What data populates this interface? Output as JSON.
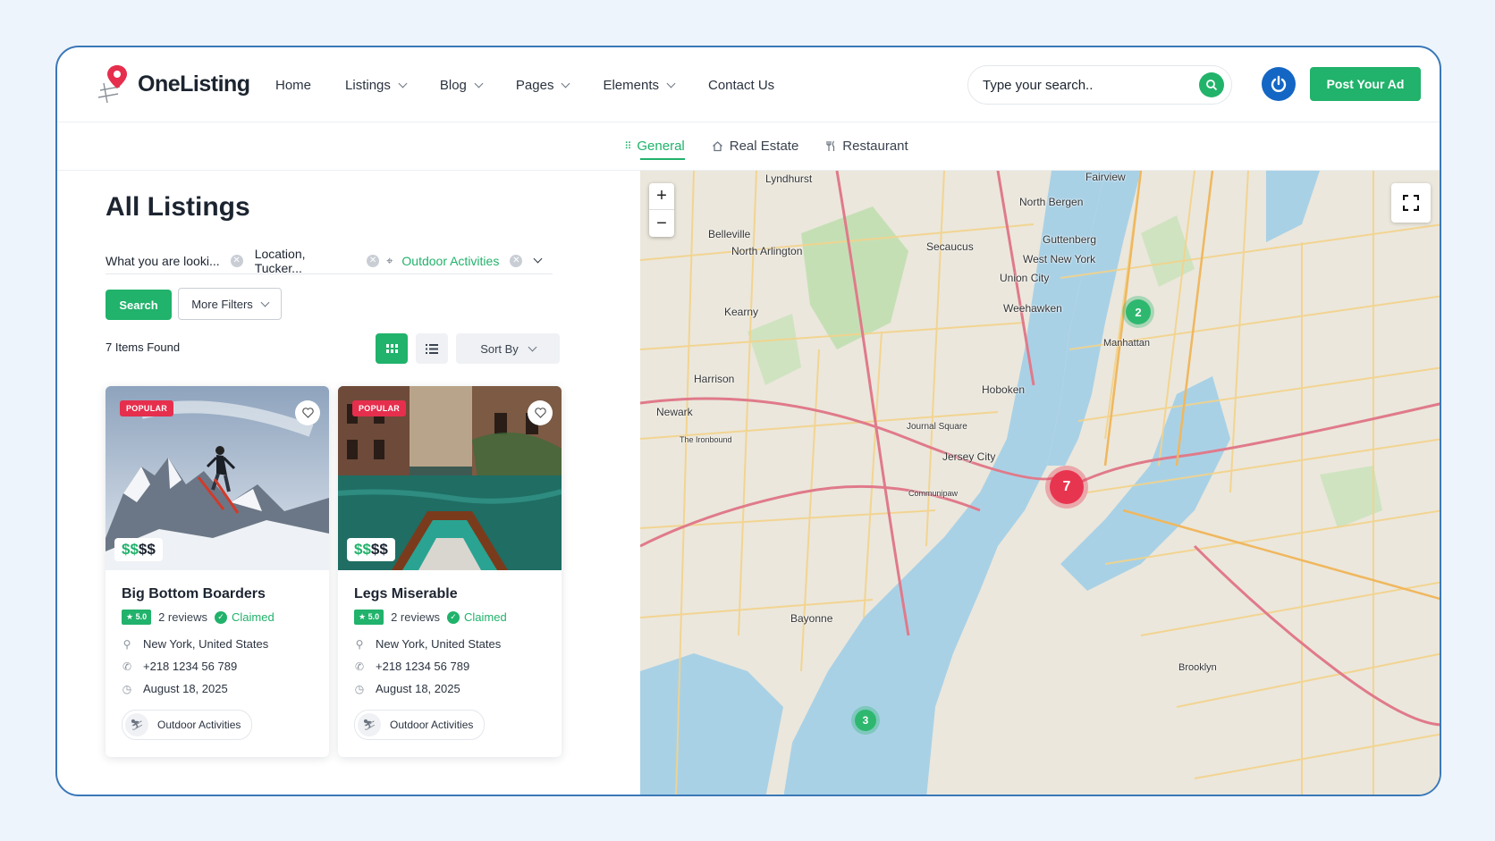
{
  "header": {
    "brand": "OneListing",
    "nav": [
      {
        "label": "Home",
        "dropdown": false
      },
      {
        "label": "Listings",
        "dropdown": true
      },
      {
        "label": "Blog",
        "dropdown": true
      },
      {
        "label": "Pages",
        "dropdown": true
      },
      {
        "label": "Elements",
        "dropdown": true
      },
      {
        "label": "Contact Us",
        "dropdown": false
      }
    ],
    "search_placeholder": "Type your search..",
    "post_button": "Post Your Ad"
  },
  "categories": [
    {
      "label": "General",
      "icon": "grid-dots-icon",
      "active": true
    },
    {
      "label": "Real Estate",
      "icon": "home-icon",
      "active": false
    },
    {
      "label": "Restaurant",
      "icon": "fork-knife-icon",
      "active": false
    }
  ],
  "listing_panel": {
    "title": "All Listings",
    "filters": {
      "keyword": "What you are looki...",
      "location": "Location, Tucker...",
      "category": "Outdoor Activities"
    },
    "search_button": "Search",
    "more_filters_button": "More Filters",
    "items_found": "7 Items Found",
    "sort_label": "Sort By"
  },
  "cards": [
    {
      "badge": "POPULAR",
      "price_active": "$$",
      "price_inactive": "$$",
      "name": "Big Bottom Boarders",
      "rating": "★ 5.0",
      "reviews": "2 reviews",
      "claimed": "Claimed",
      "location": "New York, United States",
      "phone": "+218 1234 56 789",
      "date": "August 18, 2025",
      "tag": "Outdoor Activities"
    },
    {
      "badge": "POPULAR",
      "price_active": "$$",
      "price_inactive": "$$",
      "name": "Legs Miserable",
      "rating": "★ 5.0",
      "reviews": "2 reviews",
      "claimed": "Claimed",
      "location": "New York, United States",
      "phone": "+218 1234 56 789",
      "date": "August 18, 2025",
      "tag": "Outdoor Activities"
    }
  ],
  "map": {
    "zoom_in": "+",
    "zoom_out": "−",
    "clusters": [
      "2",
      "7",
      "3"
    ],
    "labels": [
      "Lyndhurst",
      "Fairview",
      "North Bergen",
      "Belleville",
      "North Arlington",
      "Secaucus",
      "Guttenberg",
      "West New York",
      "Union City",
      "Kearny",
      "Weehawken",
      "Manhattan",
      "Harrison",
      "Hoboken",
      "Newark",
      "Jersey City",
      "Journal Square",
      "Bayonne",
      "Brooklyn",
      "Communipaw",
      "The Ironbound"
    ]
  },
  "colors": {
    "accent": "#21b26b",
    "badge": "#e62e4d",
    "cluster_red": "#e8354f",
    "cluster_green": "#2eb86f"
  }
}
